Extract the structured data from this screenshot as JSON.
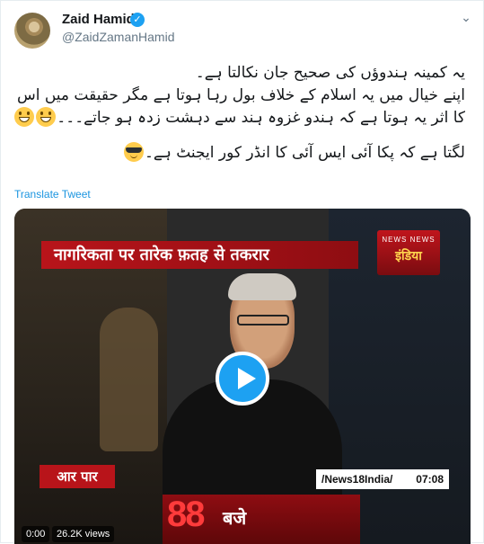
{
  "author": {
    "name": "Zaid Hamid",
    "handle": "@ZaidZamanHamid",
    "verified_mark": "✓"
  },
  "menu": {
    "chevron": "⌄"
  },
  "tweet": {
    "lines": [
      "یہ کمینہ ہندوؤں کی صحیح جان نکالتا ہے۔",
      "اپنے خیال میں یہ اسلام کے خلاف بول رہا ہوتا ہے مگر حقیقت میں اس",
      "کا اثر یہ ہوتا ہے کہ ہندو غزوہ ہند سے دہشت زدہ ہو جاتے۔۔۔",
      "لگتا ہے کہ پکا آئی ایس آئی کا انڈر کور ایجنٹ ہے۔"
    ],
    "emojis": [
      "grinning-face",
      "grinning-face",
      "smiling-face-with-sunglasses"
    ]
  },
  "translate_label": "Translate Tweet",
  "video": {
    "banner_text": "नागरिकता पर तारेक फ़तह से तकरार",
    "channel_logo_top": "NEWS NEWS",
    "channel_logo_main": "इंडिया",
    "lower_left_text": "आर पार",
    "lower_right_handle": "/News18India/",
    "lower_right_time": "07:08",
    "bottom_number": "88",
    "bottom_text": "बजे",
    "elapsed": "0:00",
    "views": "26.2K views"
  },
  "colors": {
    "link": "#1b95e0",
    "verified": "#1da1f2",
    "play_button": "#1da1f2",
    "banner_red": "#b8141a"
  }
}
